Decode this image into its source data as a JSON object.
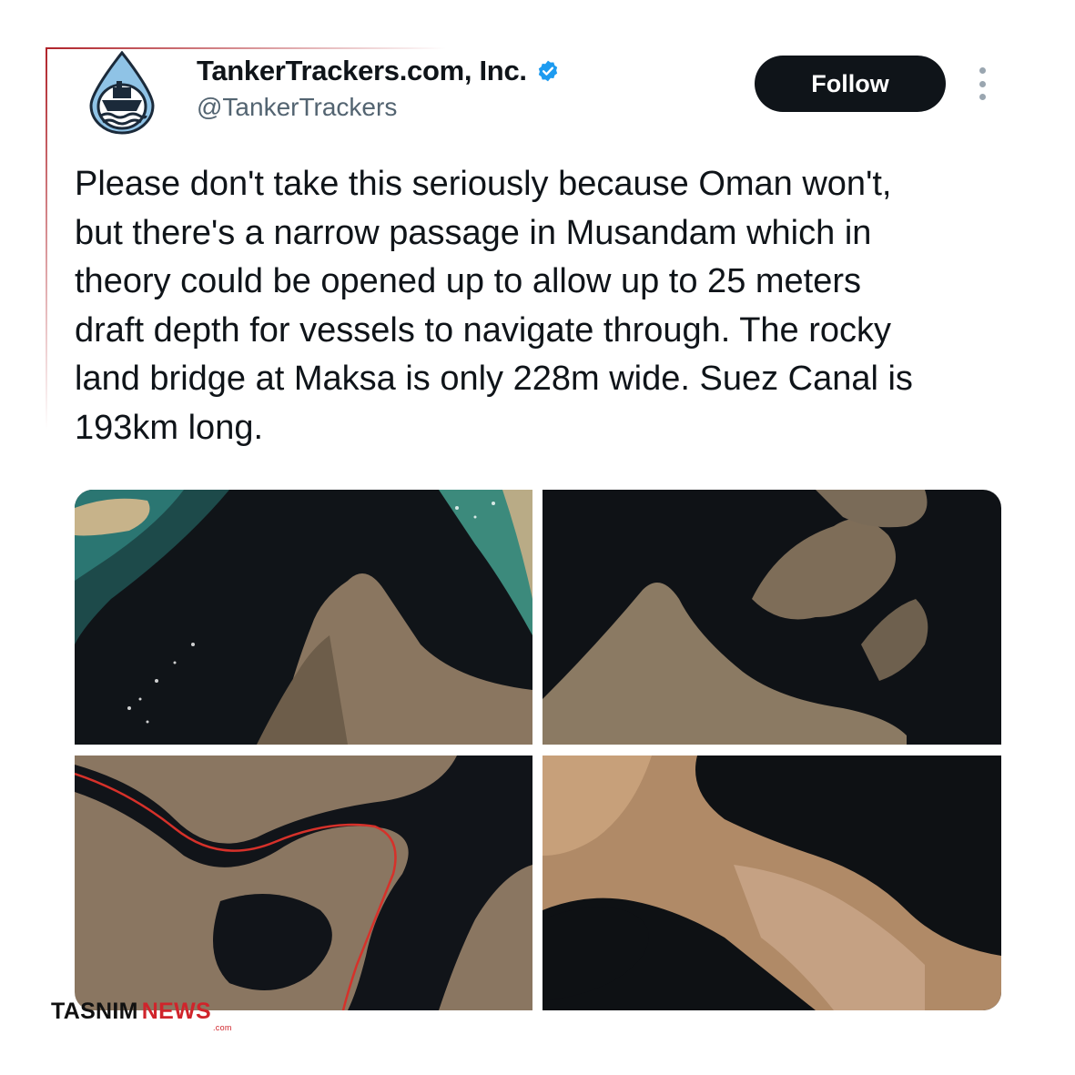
{
  "tweet": {
    "author": {
      "display_name": "TankerTrackers.com, Inc.",
      "handle": "@TankerTrackers",
      "verified_icon": "verified-badge-icon",
      "verified_color": "#1d9bf0"
    },
    "follow_label": "Follow",
    "more_icon": "more-options-icon",
    "text": "Please don't take this seriously because Oman won't,\nbut there's a narrow passage in Musandam which in\ntheory could be opened up to allow up to 25 meters\ndraft depth for vessels to navigate through. The rocky\nland bridge at Maksa is only 228m wide. Suez Canal is\n193km long.",
    "media": [
      {
        "kind": "satellite-image"
      },
      {
        "kind": "satellite-image"
      },
      {
        "kind": "satellite-image"
      },
      {
        "kind": "satellite-image"
      }
    ]
  },
  "watermark": {
    "part1": "TASNIM",
    "part2": "NEWS",
    "suffix": ".com",
    "color": "#d0242b"
  }
}
